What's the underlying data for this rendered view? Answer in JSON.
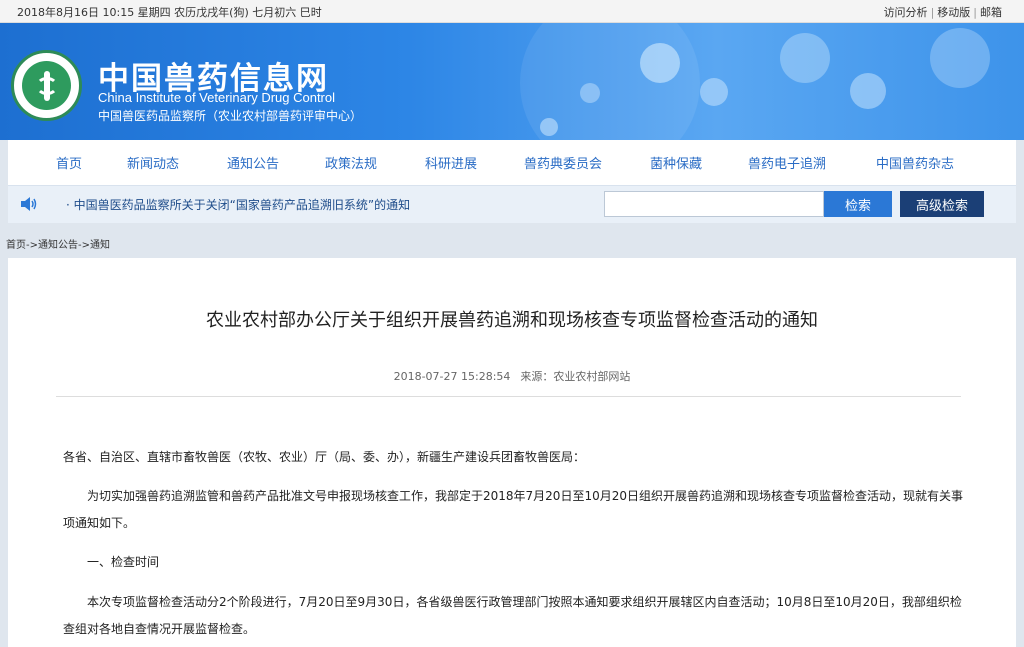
{
  "topbar": {
    "date": "2018年8月16日 10:15 星期四 农历戊戌年(狗) 七月初六 巳时",
    "links": [
      "访问分析",
      "移动版",
      "邮箱"
    ]
  },
  "header": {
    "title": "中国兽药信息网",
    "title_en": "China Institute of Veterinary Drug Control",
    "subtitle": "中国兽医药品监察所（农业农村部兽药评审中心）"
  },
  "nav": {
    "items": [
      "首页",
      "新闻动态",
      "通知公告",
      "政策法规",
      "科研进展",
      "兽药典委员会",
      "菌种保藏",
      "兽药电子追溯",
      "中国兽药杂志"
    ]
  },
  "notice": {
    "text": "· 中国兽医药品监察所关于关闭“国家兽药产品追溯旧系统”的通知"
  },
  "search": {
    "value": "",
    "button": "检索",
    "advanced": "高级检索"
  },
  "breadcrumb": [
    "首页",
    "通知公告",
    "通知"
  ],
  "article": {
    "title": "农业农村部办公厅关于组织开展兽药追溯和现场核查专项监督检查活动的通知",
    "datetime": "2018-07-27 15:28:54",
    "source": "来源：农业农村部网站",
    "paragraphs": [
      "各省、自治区、直辖市畜牧兽医（农牧、农业）厅（局、委、办），新疆生产建设兵团畜牧兽医局：",
      "为切实加强兽药追溯监管和兽药产品批准文号申报现场核查工作，我部定于2018年7月20日至10月20日组织开展兽药追溯和现场核查专项监督检查活动，现就有关事项通知如下。",
      "一、检查时间",
      "本次专项监督检查活动分2个阶段进行，7月20日至9月30日，各省级兽医行政管理部门按照本通知要求组织开展辖区内自查活动；10月8日至10月20日，我部组织检查组对各地自查情况开展监督检查。"
    ]
  },
  "colors": {
    "banner": "#2d86e6",
    "nav_text": "#2a6cc5",
    "search_button": "#2b78d6",
    "advanced_button": "#1b3f76"
  }
}
